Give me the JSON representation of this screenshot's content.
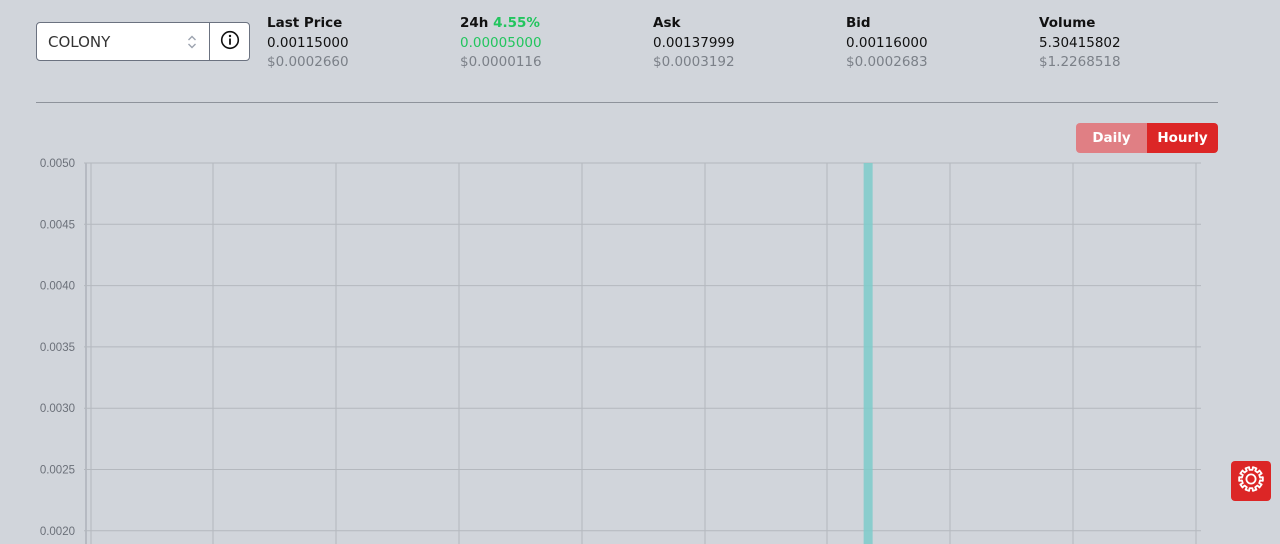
{
  "market": {
    "selected": "COLONY"
  },
  "stats": {
    "last_price": {
      "label": "Last Price",
      "value": "0.00115000",
      "usd": "$0.0002660"
    },
    "change_24h": {
      "label": "24h",
      "percent": "4.55%",
      "value": "0.00005000",
      "usd": "$0.0000116"
    },
    "ask": {
      "label": "Ask",
      "value": "0.00137999",
      "usd": "$0.0003192"
    },
    "bid": {
      "label": "Bid",
      "value": "0.00116000",
      "usd": "$0.0002683"
    },
    "volume": {
      "label": "Volume",
      "value": "5.30415802",
      "usd": "$1.2268518"
    }
  },
  "toggle": {
    "daily_label": "Daily",
    "hourly_label": "Hourly",
    "active": "Hourly"
  },
  "colors": {
    "positive": "#22c55e",
    "accent": "#dc2626",
    "inactive": "#e07f84",
    "bar": "#7ecbca"
  },
  "icons": {
    "info": "info-icon",
    "settings": "gear-icon",
    "select_arrows": "chevron-updown-icon"
  },
  "chart_data": {
    "type": "bar",
    "ylim": [
      0.002,
      0.005
    ],
    "y_ticks": [
      "0.0050",
      "0.0045",
      "0.0040",
      "0.0035",
      "0.0030",
      "0.0025",
      "0.0020"
    ],
    "tick_values": [
      0.005,
      0.0045,
      0.004,
      0.0035,
      0.003,
      0.0025,
      0.002
    ],
    "grid": true,
    "bars": [
      {
        "slot": 0.702,
        "value": 0.005
      }
    ]
  }
}
